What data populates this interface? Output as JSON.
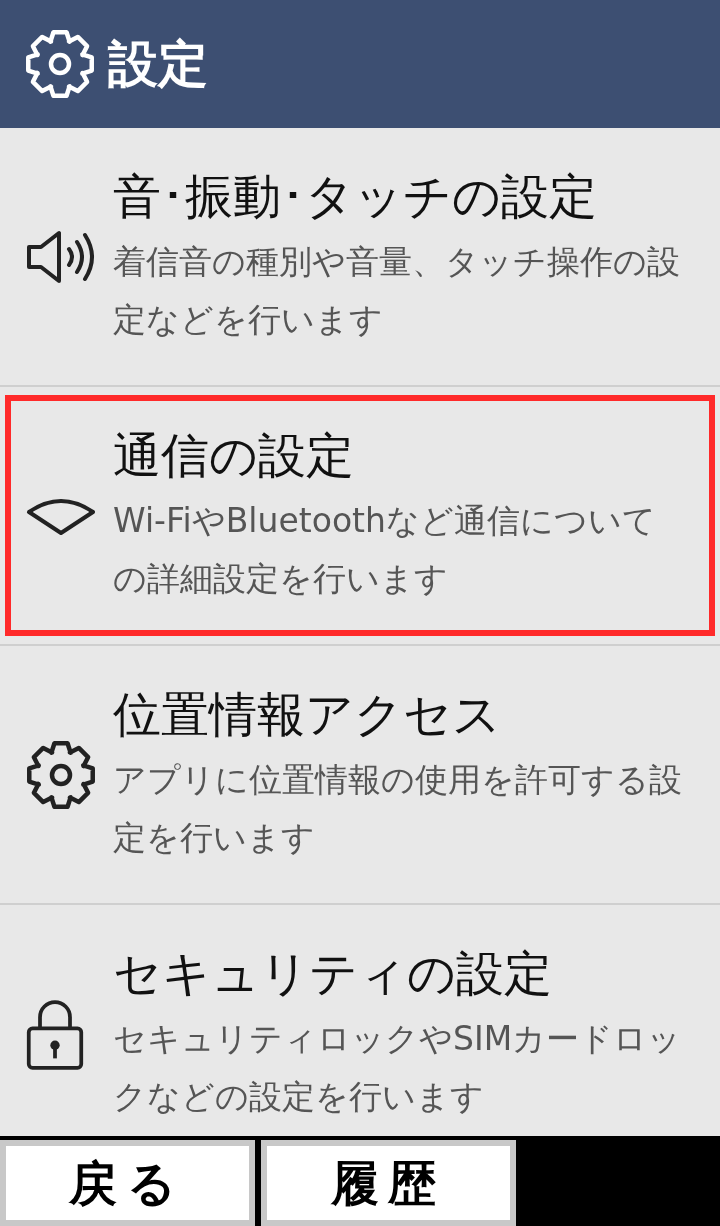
{
  "header": {
    "title": "設定"
  },
  "items": [
    {
      "kind": "sound",
      "title": "音･振動･タッチの設定",
      "description": "着信音の種別や音量、タッチ操作の設定などを行います",
      "selected": false
    },
    {
      "kind": "wireless",
      "title": "通信の設定",
      "description": "Wi-FiやBluetoothなど通信についての詳細設定を行います",
      "selected": true
    },
    {
      "kind": "gear",
      "title": "位置情報アクセス",
      "description": "アプリに位置情報の使用を許可する設定を行います",
      "selected": false
    },
    {
      "kind": "lock",
      "title": "セキュリティの設定",
      "description": "セキュリティロックやSIMカードロックなどの設定を行います",
      "selected": false
    }
  ],
  "buttons": [
    "戻る",
    "履歴"
  ]
}
